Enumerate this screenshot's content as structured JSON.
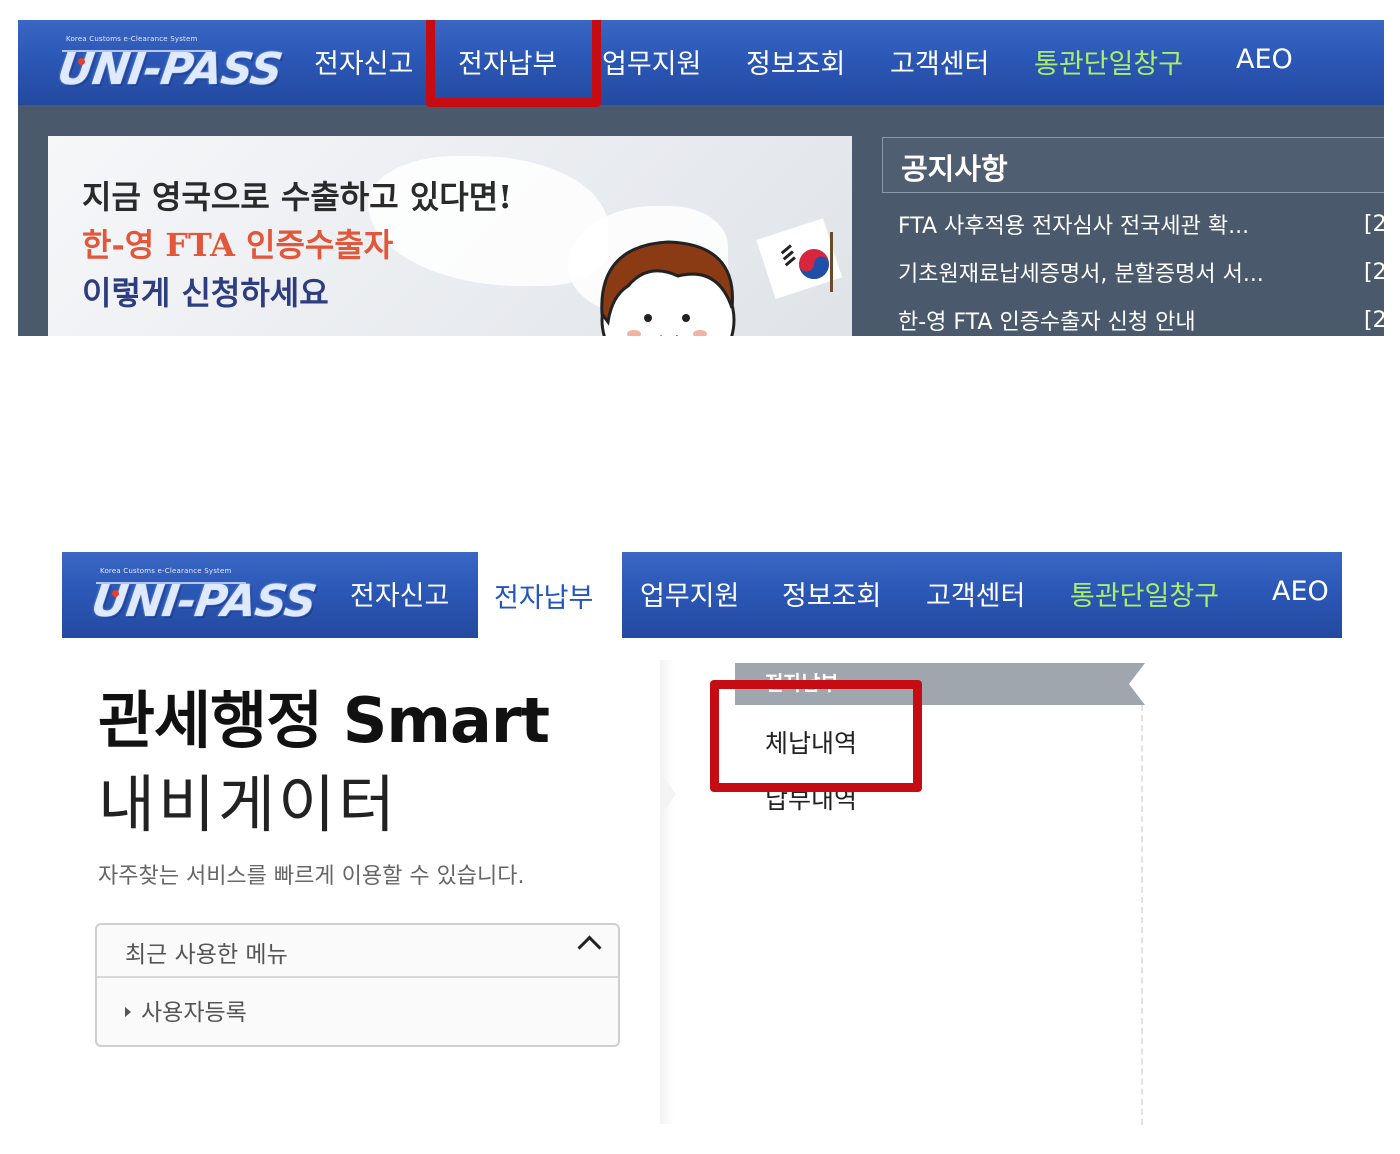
{
  "logo": {
    "tagline": "Korea Customs e-Clearance System",
    "wordmark": "UNI-PASS"
  },
  "nav": {
    "items": [
      {
        "label": "전자신고"
      },
      {
        "label": "전자납부"
      },
      {
        "label": "업무지원"
      },
      {
        "label": "정보조회"
      },
      {
        "label": "고객센터"
      },
      {
        "label": "통관단일창구"
      },
      {
        "label": "AEO"
      }
    ]
  },
  "banner": {
    "line1": "지금 영국으로 수출하고 있다면!",
    "line2": "한-영 FTA 인증수출자",
    "line3": "이렇게 신청하세요"
  },
  "notice": {
    "title": "공지사항",
    "items": [
      {
        "text": "FTA 사후적용 전자심사 전국세관 확...",
        "date": "[2"
      },
      {
        "text": "기초원재료납세증명서, 분할증명서 서...",
        "date": "[2"
      },
      {
        "text": "한-영 FTA 인증수출자 신청 안내",
        "date": "[2"
      }
    ]
  },
  "navigator": {
    "title_bold": "관세행정 Smart",
    "title_light": "내비게이터",
    "description": "자주찾는 서비스를 빠르게 이용할 수 있습니다.",
    "recent_header": "최근 사용한 메뉴",
    "recent_items": [
      "사용자등록"
    ]
  },
  "submenu": {
    "header": "전자납부",
    "items": [
      "체납내역",
      "납부내역"
    ]
  },
  "colors": {
    "nav_blue": "#2b57b6",
    "highlight_red": "#c40c12",
    "active_tab_text": "#2355c2",
    "green_menu": "#a9ef6a"
  }
}
